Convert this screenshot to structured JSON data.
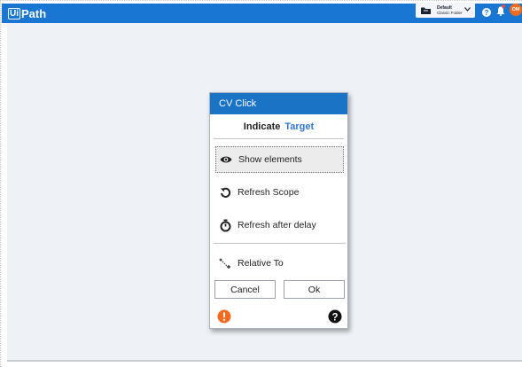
{
  "header": {
    "logo_prefix": "Ui",
    "logo_suffix": "Path",
    "folder_picker": {
      "line1": "Default",
      "line2": "Classic Folder"
    },
    "avatar_initials": "OM",
    "colors": {
      "bar": "#1976d2",
      "avatar": "#f26b21"
    }
  },
  "dialog": {
    "title": "CV Click",
    "indicate_label": "Indicate",
    "target_label": "Target",
    "items": [
      {
        "label": "Show elements",
        "icon": "eye-icon",
        "selected": true
      },
      {
        "label": "Refresh Scope",
        "icon": "refresh-icon"
      },
      {
        "label": "Refresh after delay",
        "icon": "timer-icon"
      },
      {
        "label": "Relative To",
        "icon": "relative-arrows-icon"
      }
    ],
    "cancel_label": "Cancel",
    "ok_label": "Ok",
    "footer_icons": [
      "warning-icon",
      "help-icon"
    ]
  }
}
